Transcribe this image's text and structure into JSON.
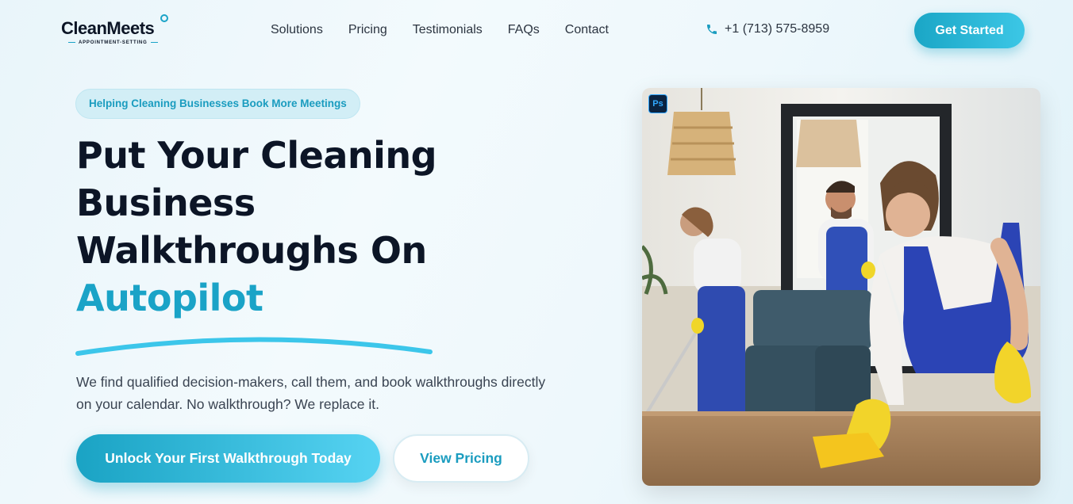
{
  "brand": {
    "name": "CleanMeets",
    "tagline": "APPOINTMENT-SETTING"
  },
  "nav": {
    "items": [
      {
        "label": "Solutions"
      },
      {
        "label": "Pricing"
      },
      {
        "label": "Testimonials"
      },
      {
        "label": "FAQs"
      },
      {
        "label": "Contact"
      }
    ]
  },
  "contact": {
    "phone": "+1 (713) 575-8959",
    "icon": "phone-icon"
  },
  "header": {
    "cta_label": "Get Started"
  },
  "hero": {
    "badge": "Helping Cleaning Businesses Book More Meetings",
    "headline_lines": [
      "Put Your Cleaning",
      "Business",
      "Walkthroughs On"
    ],
    "headline_accent": "Autopilot",
    "subtext": "We find qualified decision-makers, call them, and book walkthroughs directly on your calendar. No walkthrough? We replace it.",
    "primary_cta": "Unlock Your First Walkthrough Today",
    "secondary_cta": "View Pricing",
    "image_badge": "Ps"
  },
  "colors": {
    "accent": "#1aa3c7",
    "heading": "#0c1526",
    "body_text": "#3a4452"
  }
}
